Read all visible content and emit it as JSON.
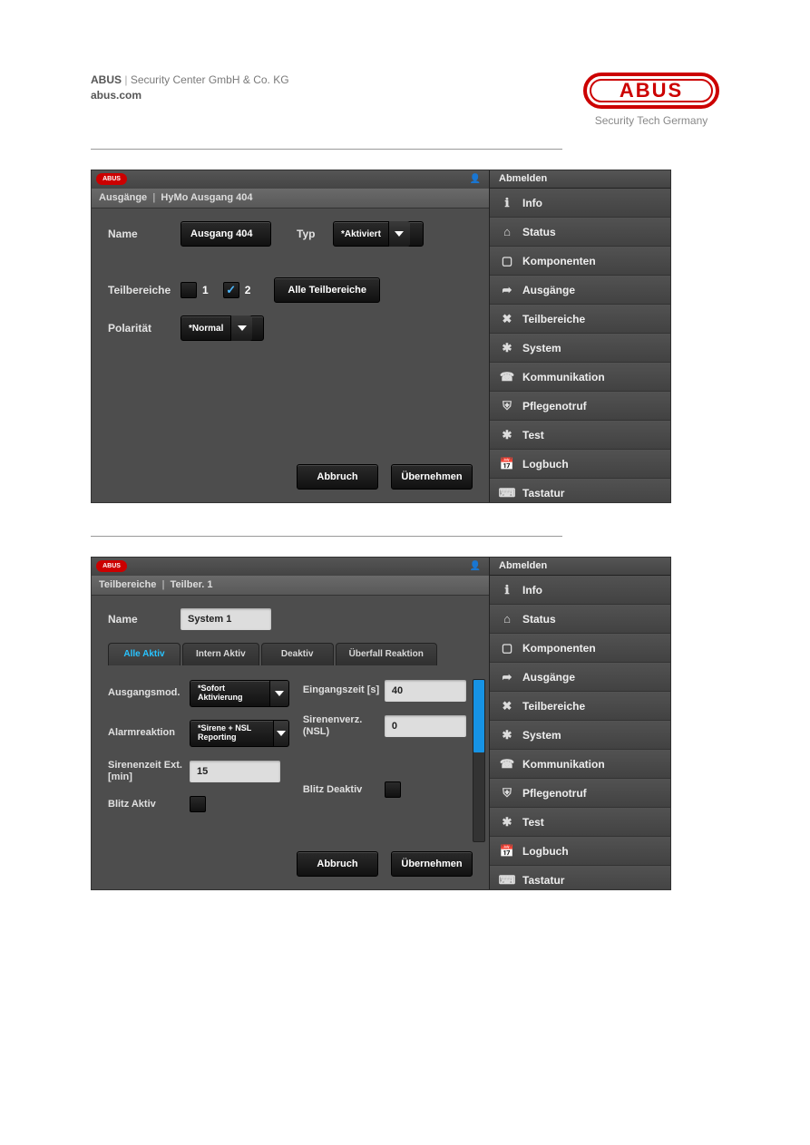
{
  "doc_header": {
    "brand": "ABUS",
    "company": "Security Center GmbH & Co. KG",
    "website": "abus.com",
    "logo_text": "ABUS",
    "tagline": "Security Tech Germany"
  },
  "sidebar": {
    "logout": "Abmelden",
    "items": [
      {
        "label": "Info",
        "icon": "ℹ"
      },
      {
        "label": "Status",
        "icon": "⌂"
      },
      {
        "label": "Komponenten",
        "icon": "▢"
      },
      {
        "label": "Ausgänge",
        "icon": "➦"
      },
      {
        "label": "Teilbereiche",
        "icon": "✖"
      },
      {
        "label": "System",
        "icon": "✱"
      },
      {
        "label": "Kommunikation",
        "icon": "☎"
      },
      {
        "label": "Pflegenotruf",
        "icon": "⛨"
      },
      {
        "label": "Test",
        "icon": "✱"
      },
      {
        "label": "Logbuch",
        "icon": "📅"
      },
      {
        "label": "Tastatur",
        "icon": "⌨"
      }
    ]
  },
  "screenshot1": {
    "breadcrumb": {
      "section": "Ausgänge",
      "page": "HyMo Ausgang 404"
    },
    "fields": {
      "name_label": "Name",
      "name_value": "Ausgang 404",
      "typ_label": "Typ",
      "typ_value": "*Aktiviert",
      "teilbereiche_label": "Teilbereiche",
      "cb1_label": "1",
      "cb1_checked": false,
      "cb2_label": "2",
      "cb2_checked": true,
      "alle_tb_label": "Alle Teilbereiche",
      "polaritaet_label": "Polarität",
      "polaritaet_value": "*Normal"
    },
    "buttons": {
      "cancel": "Abbruch",
      "apply": "Übernehmen"
    }
  },
  "screenshot2": {
    "breadcrumb": {
      "section": "Teilbereiche",
      "page": "Teilber. 1"
    },
    "fields": {
      "name_label": "Name",
      "name_value": "System 1",
      "ausgangsmod_label": "Ausgangsmod.",
      "ausgangsmod_value": "*Sofort Aktivierung",
      "alarmreaktion_label": "Alarmreaktion",
      "alarmreaktion_value": "*Sirene + NSL Reporting",
      "sirenenzeit_label": "Sirenenzeit Ext. [min]",
      "sirenenzeit_value": "15",
      "blitz_aktiv_label": "Blitz Aktiv",
      "blitz_aktiv_checked": false,
      "eingangszeit_label": "Eingangszeit [s]",
      "eingangszeit_value": "40",
      "sirenenverz_label": "Sirenenverz. (NSL)",
      "sirenenverz_value": "0",
      "blitz_deaktiv_label": "Blitz Deaktiv",
      "blitz_deaktiv_checked": false
    },
    "tabs": [
      {
        "label": "Alle Aktiv",
        "active": true
      },
      {
        "label": "Intern Aktiv",
        "active": false
      },
      {
        "label": "Deaktiv",
        "active": false
      },
      {
        "label": "Überfall Reaktion",
        "active": false
      }
    ],
    "buttons": {
      "cancel": "Abbruch",
      "apply": "Übernehmen"
    }
  }
}
